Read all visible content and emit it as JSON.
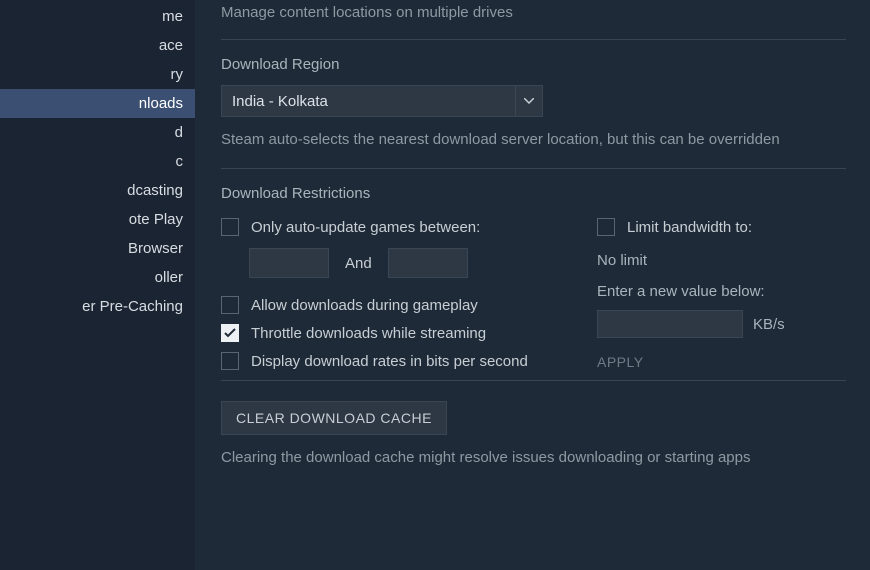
{
  "sidebar": {
    "activeIndex": 3,
    "items": [
      {
        "label": "me"
      },
      {
        "label": "ace"
      },
      {
        "label": "ry"
      },
      {
        "label": "nloads"
      },
      {
        "label": "d"
      },
      {
        "label": "c"
      },
      {
        "label": "dcasting"
      },
      {
        "label": "ote Play"
      },
      {
        "label": "Browser"
      },
      {
        "label": "oller"
      },
      {
        "label": "er Pre-Caching"
      }
    ]
  },
  "main": {
    "manage_desc": "Manage content locations on multiple drives",
    "region_title": "Download Region",
    "region_value": "India - Kolkata",
    "region_note": "Steam auto-selects the nearest download server location, but this can be overridden",
    "restrictions_title": "Download Restrictions",
    "chk_autoupdate_label": "Only auto-update games between:",
    "and_text": "And",
    "chk_allow_gameplay_label": "Allow downloads during gameplay",
    "chk_throttle_label": "Throttle downloads while streaming",
    "chk_bits_label": "Display download rates in bits per second",
    "chk_limit_bw_label": "Limit bandwidth to:",
    "nolimit_text": "No limit",
    "enter_value_label": "Enter a new value below:",
    "kbps_label": "KB/s",
    "apply_label": "APPLY",
    "clear_cache_label": "CLEAR DOWNLOAD CACHE",
    "clear_cache_note": "Clearing the download cache might resolve issues downloading or starting apps"
  }
}
